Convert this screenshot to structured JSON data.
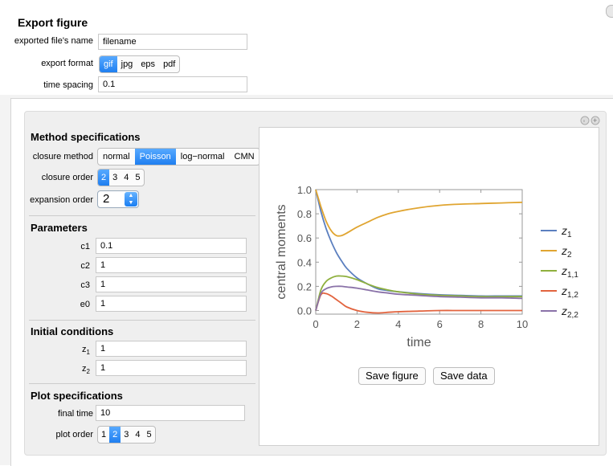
{
  "export": {
    "title": "Export figure",
    "filename_label": "exported file's name",
    "filename_value": "filename",
    "format_label": "export format",
    "formats": [
      "gif",
      "jpg",
      "eps",
      "pdf"
    ],
    "format_selected": "gif",
    "spacing_label": "time spacing",
    "spacing_value": "0.1"
  },
  "method": {
    "title": "Method specifications",
    "closure_method_label": "closure method",
    "closure_methods": [
      "normal",
      "Poisson",
      "log−normal",
      "CMN"
    ],
    "closure_method_selected": "Poisson",
    "closure_order_label": "closure order",
    "closure_orders": [
      "2",
      "3",
      "4",
      "5"
    ],
    "closure_order_selected": "2",
    "expansion_order_label": "expansion order",
    "expansion_order_value": "2"
  },
  "parameters": {
    "title": "Parameters",
    "items": [
      {
        "label": "c1",
        "value": "0.1"
      },
      {
        "label": "c2",
        "value": "1"
      },
      {
        "label": "c3",
        "value": "1"
      },
      {
        "label": "e0",
        "value": "1"
      }
    ]
  },
  "initial": {
    "title": "Initial conditions",
    "items": [
      {
        "label_main": "z",
        "label_sub": "1",
        "value": "1"
      },
      {
        "label_main": "z",
        "label_sub": "2",
        "value": "1"
      }
    ]
  },
  "plot_spec": {
    "title": "Plot specifications",
    "final_time_label": "final time",
    "final_time_value": "10",
    "plot_order_label": "plot order",
    "plot_orders": [
      "1",
      "2",
      "3",
      "4",
      "5"
    ],
    "plot_order_selected": "2"
  },
  "buttons": {
    "save_figure": "Save figure",
    "save_data": "Save data"
  },
  "chart_data": {
    "type": "line",
    "title": "",
    "xlabel": "time",
    "ylabel": "central moments",
    "xlim": [
      0,
      10
    ],
    "ylim": [
      -0.03,
      1.0
    ],
    "xticks": [
      "0",
      "2",
      "4",
      "6",
      "8",
      "10"
    ],
    "yticks": [
      "0.0",
      "0.2",
      "0.4",
      "0.6",
      "0.8",
      "1.0"
    ],
    "x": [
      0,
      0.25,
      0.5,
      0.75,
      1,
      1.25,
      1.5,
      2,
      2.5,
      3,
      3.5,
      4,
      5,
      6,
      7,
      8,
      9,
      10
    ],
    "series": [
      {
        "name_main": "z",
        "name_sub": "1",
        "color": "#5b7fbf",
        "values": [
          1.0,
          0.82,
          0.68,
          0.57,
          0.48,
          0.41,
          0.35,
          0.27,
          0.22,
          0.18,
          0.165,
          0.155,
          0.14,
          0.13,
          0.125,
          0.12,
          0.12,
          0.12
        ]
      },
      {
        "name_main": "z",
        "name_sub": "2",
        "color": "#e0a531",
        "values": [
          1.0,
          0.86,
          0.74,
          0.66,
          0.62,
          0.62,
          0.64,
          0.69,
          0.73,
          0.77,
          0.8,
          0.82,
          0.85,
          0.87,
          0.88,
          0.885,
          0.89,
          0.895
        ]
      },
      {
        "name_main": "z",
        "name_sub": "1,1",
        "color": "#8fb03e",
        "values": [
          0.0,
          0.17,
          0.24,
          0.27,
          0.285,
          0.285,
          0.28,
          0.255,
          0.22,
          0.19,
          0.17,
          0.155,
          0.135,
          0.125,
          0.12,
          0.115,
          0.115,
          0.115
        ]
      },
      {
        "name_main": "z",
        "name_sub": "1,2",
        "color": "#e2643f",
        "values": [
          0.0,
          0.13,
          0.14,
          0.12,
          0.09,
          0.06,
          0.03,
          0.0,
          -0.015,
          -0.02,
          -0.015,
          -0.01,
          -0.005,
          0.0,
          0.0,
          0.0,
          0.0,
          0.0
        ]
      },
      {
        "name_main": "z",
        "name_sub": "2,2",
        "color": "#8a72a8",
        "values": [
          0.0,
          0.14,
          0.18,
          0.195,
          0.2,
          0.2,
          0.195,
          0.185,
          0.17,
          0.155,
          0.145,
          0.135,
          0.125,
          0.115,
          0.11,
          0.105,
          0.105,
          0.1
        ]
      }
    ],
    "legend_position": "right",
    "grid": false
  }
}
